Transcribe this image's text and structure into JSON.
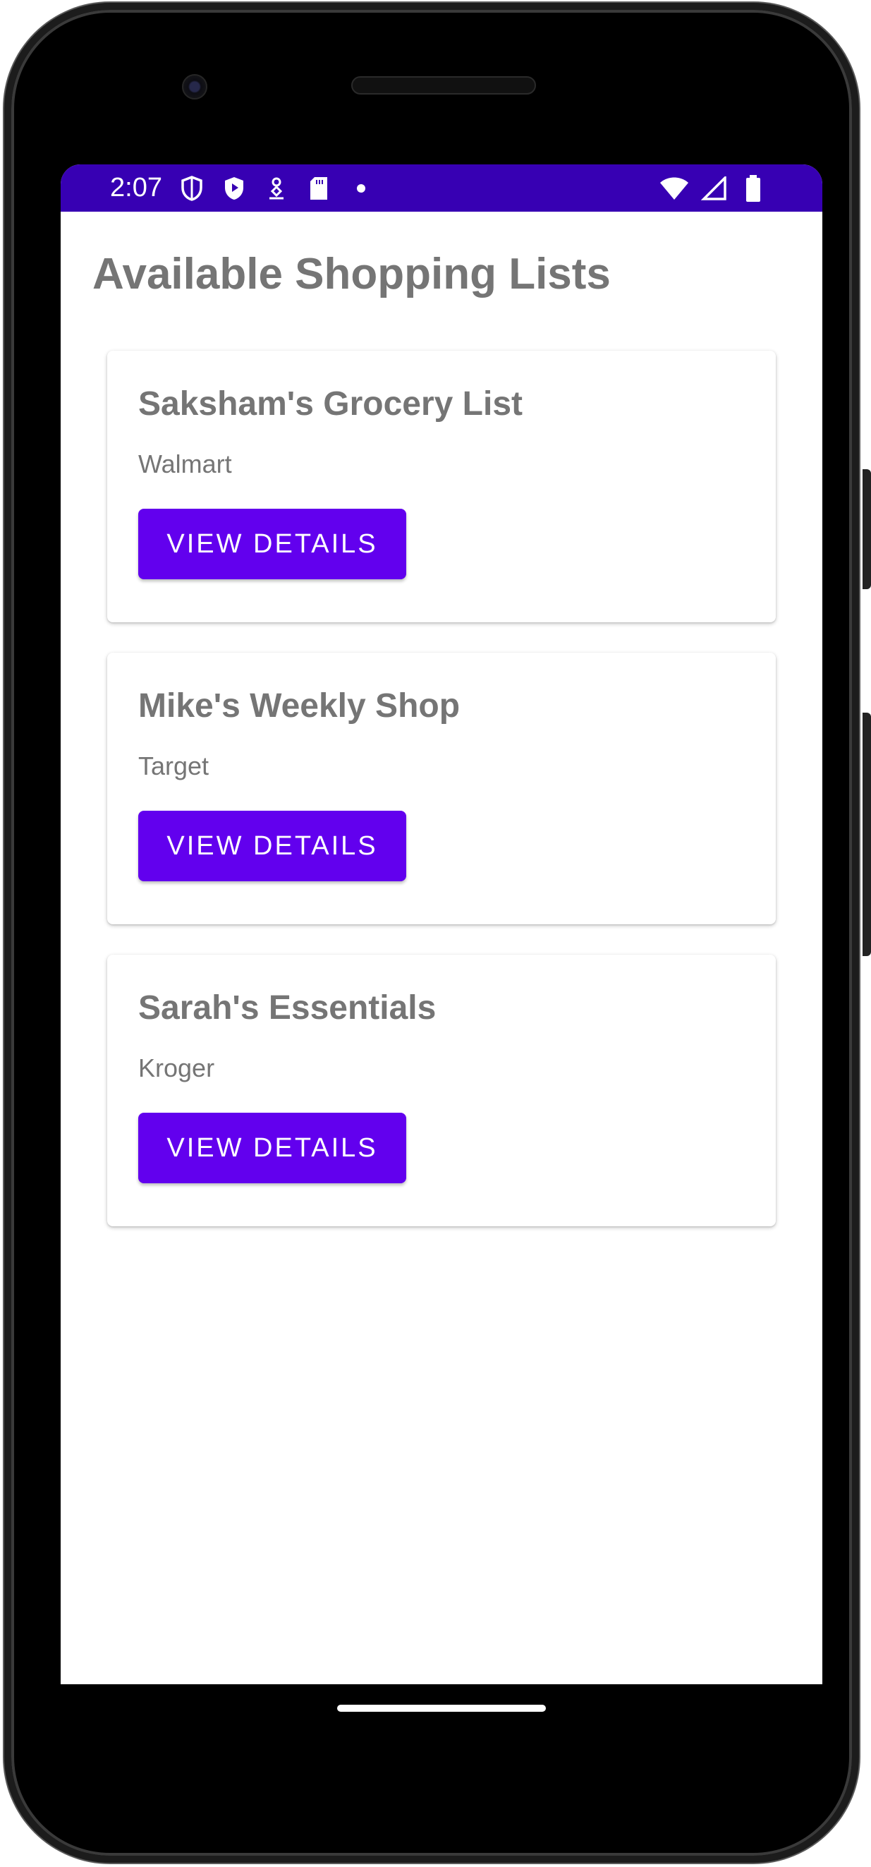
{
  "status_bar": {
    "time": "2:07",
    "icons_left": [
      "shield-outline-icon",
      "play-shield-icon",
      "location-pin-icon",
      "sd-card-icon",
      "dot-icon"
    ],
    "icons_right": [
      "wifi-icon",
      "signal-icon",
      "battery-icon"
    ],
    "background_color": "#3700b3"
  },
  "page": {
    "title": "Available Shopping Lists"
  },
  "lists": [
    {
      "name": "Saksham's Grocery List",
      "store": "Walmart",
      "button_label": "VIEW DETAILS"
    },
    {
      "name": "Mike's Weekly Shop",
      "store": "Target",
      "button_label": "VIEW DETAILS"
    },
    {
      "name": "Sarah's Essentials",
      "store": "Kroger",
      "button_label": "VIEW DETAILS"
    }
  ],
  "colors": {
    "button": "#6200ee",
    "text": "#757575"
  }
}
